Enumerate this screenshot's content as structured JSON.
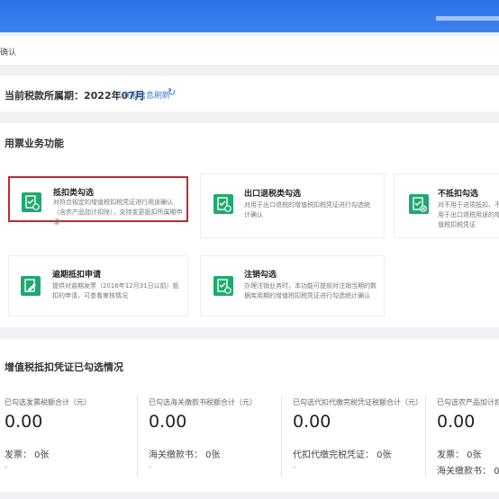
{
  "breadcrumb": "确认",
  "tax_period": {
    "label": "当前税款所属期：2022年07月",
    "refresh_label": "申报信息刷新"
  },
  "functions": {
    "title": "用票业务功能",
    "cards": [
      {
        "title": "抵扣类勾选",
        "desc": "对符合规定的增值税扣税凭证进行用途确认（含农产品加计扣除），支持变更抵扣所属期申请",
        "icon": "checklist-icon"
      },
      {
        "title": "出口退税类勾选",
        "desc": "对用于出口退税的增值税扣税凭证进行勾选统计确认",
        "icon": "checklist-icon"
      },
      {
        "title": "不抵扣勾选",
        "desc": "对不用于进项抵扣、不用于出口退税用途的增值税扣税凭证",
        "icon": "checklist-x-icon"
      },
      {
        "title": "逾期抵扣申请",
        "desc": "提供对逾期发票（2016年12月31日以前）抵扣的申请，可查看审核情况",
        "icon": "edit-doc-icon"
      },
      {
        "title": "注销勾选",
        "desc": "办理注销业务时，本功能可提前对注销当期的数据库用期的增值税扣税凭证进行勾选统计确认",
        "icon": "checklist-icon"
      }
    ]
  },
  "stats": {
    "title": "增值税抵扣凭证已勾选情况",
    "columns": [
      {
        "label": "已勾选发票税额合计（元）",
        "value": "0.00",
        "count": "发票：  0张",
        "dash": "-"
      },
      {
        "label": "已勾选海关缴款书税额合计（元）",
        "value": "0.00",
        "count": "海关缴款书：  0张",
        "dash": "-"
      },
      {
        "label": "已勾选代扣代缴完税凭证税额合计（元）",
        "value": "0.00",
        "count": "代扣代缴完税凭证：  0张",
        "dash": "-"
      },
      {
        "label": "已勾选农产品加计扣",
        "value": "0.00",
        "count": "发票：  0张",
        "count2": "海关缴款书：  0张",
        "dash": "-"
      }
    ]
  },
  "colors": {
    "accent": "#3a7bd5",
    "icon_green": "#1fa971",
    "highlight": "#c9252b",
    "topbar": "#2d72e6"
  }
}
